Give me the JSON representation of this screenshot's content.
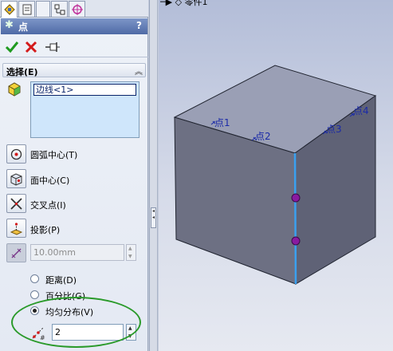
{
  "tabs": [
    {
      "icon": "feature-manager-icon",
      "active": true
    },
    {
      "icon": "property-manager-icon",
      "active": false
    },
    {
      "icon": "configuration-manager-icon",
      "active": false
    },
    {
      "icon": "dimxpert-icon",
      "active": false
    }
  ],
  "panel": {
    "title": "点",
    "help": "?"
  },
  "selection": {
    "group_label": "选择(E)",
    "list_item": "边线<1>"
  },
  "options": [
    {
      "label": "圆弧中心(T)",
      "icon": "arc-center-icon"
    },
    {
      "label": "面中心(C)",
      "icon": "face-center-icon"
    },
    {
      "label": "交叉点(I)",
      "icon": "intersection-icon"
    },
    {
      "label": "投影(P)",
      "icon": "projection-icon"
    }
  ],
  "distance": {
    "value": "10.00mm"
  },
  "radios": [
    {
      "label": "距离(D)",
      "checked": false
    },
    {
      "label": "百分比(G)",
      "checked": false
    },
    {
      "label": "均匀分布(V)",
      "checked": true
    }
  ],
  "count": {
    "value": "2"
  },
  "tree": {
    "node": "零件1"
  },
  "viewport": {
    "points": [
      "点1",
      "点2",
      "点3",
      "点4"
    ]
  },
  "colors": {
    "accent": "#4f6aa6",
    "highlight_edge": "#3aa0f0",
    "point_marker": "#8a1aa0",
    "ellipse": "#2a9a2a",
    "point_label": "#1a2aa8"
  }
}
